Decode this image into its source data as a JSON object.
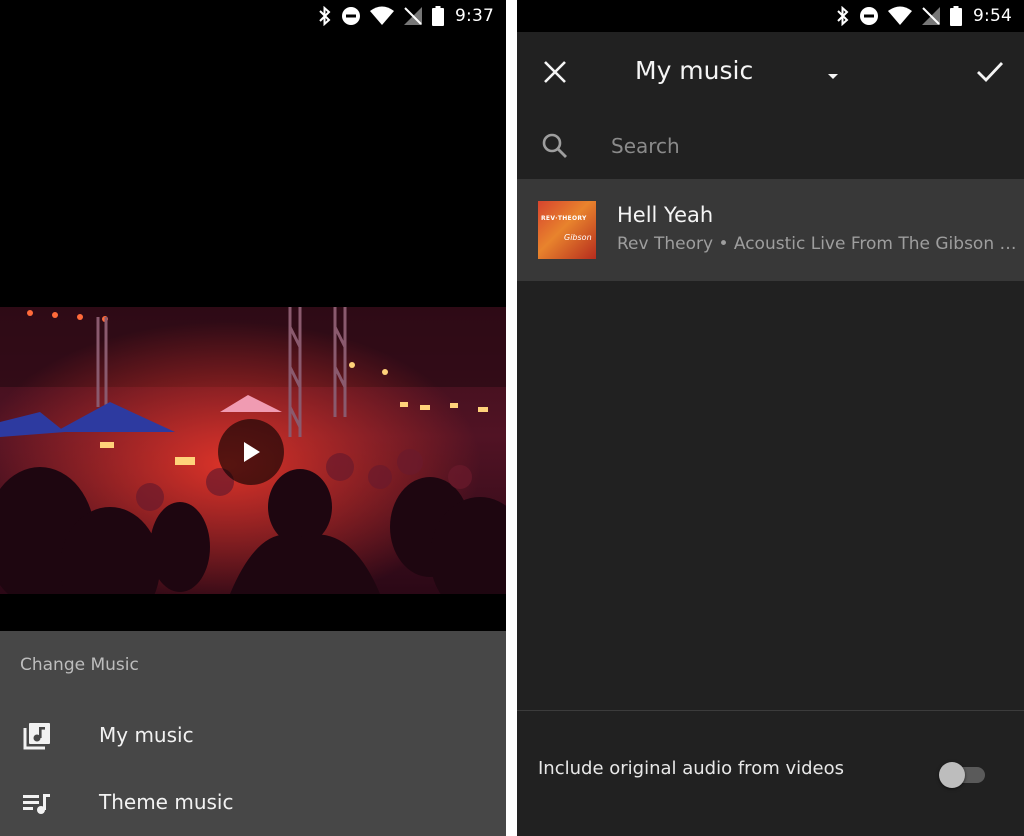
{
  "left_screen": {
    "status_bar": {
      "time": "9:37"
    },
    "video": {
      "play_icon": "play-icon"
    },
    "change_music": {
      "title": "Change Music",
      "items": [
        {
          "label": "My music",
          "icon": "music-library-icon"
        },
        {
          "label": "Theme music",
          "icon": "playlist-music-icon"
        }
      ]
    }
  },
  "right_screen": {
    "status_bar": {
      "time": "9:54"
    },
    "toolbar": {
      "title": "My music",
      "close_icon": "close-icon",
      "dropdown_icon": "dropdown-arrow-icon",
      "confirm_icon": "check-icon"
    },
    "search": {
      "placeholder": "Search",
      "value": ""
    },
    "tracks": [
      {
        "title": "Hell Yeah",
        "subtitle": "Rev Theory • Acoustic Live From The Gibson Showroom"
      }
    ],
    "include_audio": {
      "label": "Include original audio from videos",
      "enabled": false
    }
  },
  "colors": {
    "dark_background": "#212121",
    "sheet_background": "#474747",
    "selected_row": "#383838"
  }
}
